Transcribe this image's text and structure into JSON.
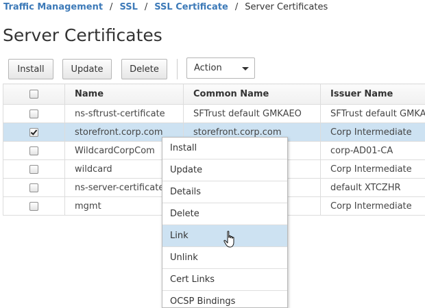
{
  "breadcrumb": {
    "items": [
      {
        "label": "Traffic Management"
      },
      {
        "label": "SSL"
      },
      {
        "label": "SSL Certificate"
      },
      {
        "label": "Server Certificates"
      }
    ],
    "separator": "/"
  },
  "page": {
    "title": "Server Certificates"
  },
  "toolbar": {
    "install_label": "Install",
    "update_label": "Update",
    "delete_label": "Delete",
    "action_label": "Action"
  },
  "table": {
    "columns": [
      "Name",
      "Common Name",
      "Issuer Name"
    ],
    "rows": [
      {
        "name": "ns-sftrust-certificate",
        "common_name": "SFTrust default GMKAEO",
        "issuer": "SFTrust default GMKAEO",
        "checked": false
      },
      {
        "name": "storefront.corp.com",
        "common_name": "storefront.corp.com",
        "issuer": "Corp Intermediate",
        "checked": true
      },
      {
        "name": "WildcardCorpCom",
        "common_name": "",
        "issuer": "corp-AD01-CA",
        "checked": false
      },
      {
        "name": "wildcard",
        "common_name": "",
        "issuer": "Corp Intermediate",
        "checked": false
      },
      {
        "name": "ns-server-certificate",
        "common_name": "",
        "issuer": "default XTCZHR",
        "checked": false
      },
      {
        "name": "mgmt",
        "common_name": "",
        "issuer": "Corp Intermediate",
        "checked": false
      }
    ]
  },
  "context_menu": {
    "items": [
      "Install",
      "Update",
      "Details",
      "Delete",
      "Link",
      "Unlink",
      "Cert Links",
      "OCSP Bindings"
    ],
    "highlighted": "Link"
  },
  "colors": {
    "link": "#3d7ab8",
    "selection": "#cde2f2",
    "border": "#dcdcdc"
  },
  "icons": [
    "checkbox-icon",
    "checkmark-icon",
    "caret-down-icon",
    "hand-pointer-cursor-icon"
  ]
}
